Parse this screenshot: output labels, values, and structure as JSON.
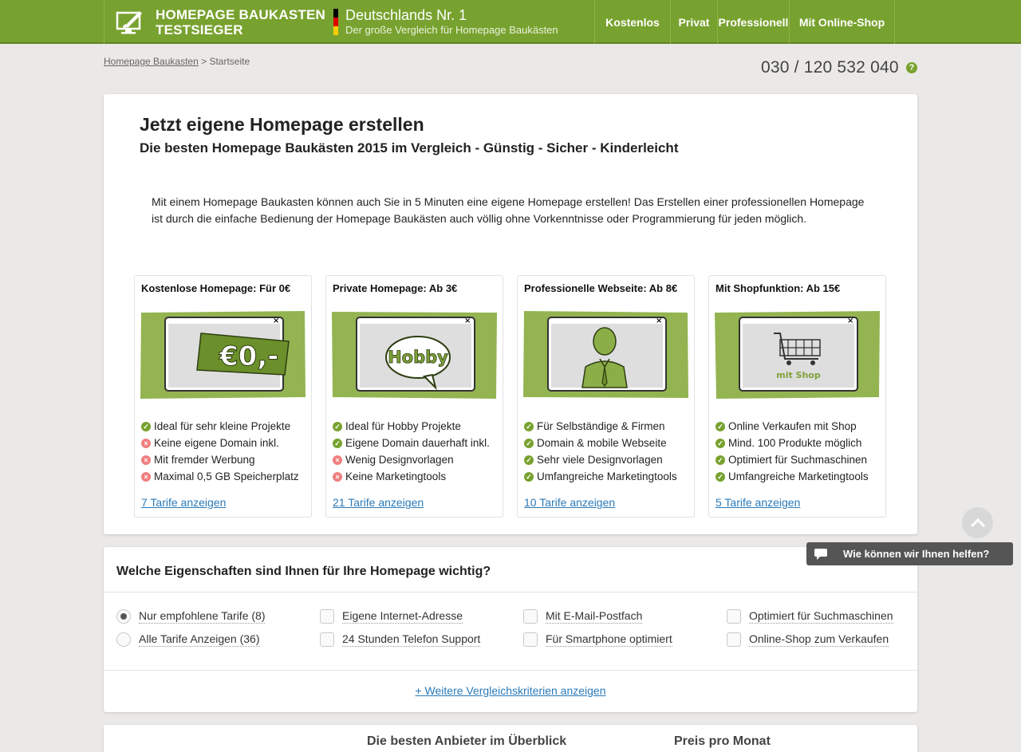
{
  "header": {
    "logo_line1": "HOMEPAGE BAUKASTEN",
    "logo_line2": "TESTSIEGER",
    "tagline_title": "Deutschlands Nr. 1",
    "tagline_sub": "Der große Vergleich für Homepage Baukästen",
    "nav": [
      "Kostenlos",
      "Privat",
      "Professionell",
      "Mit Online-Shop"
    ],
    "brand_color": "#78a22f"
  },
  "breadcrumb": {
    "link": "Homepage Baukasten",
    "separator": ">",
    "current": "Startseite"
  },
  "phone": "030 / 120 532 040",
  "hero": {
    "title": "Jetzt eigene Homepage erstellen",
    "subtitle": "Die besten Homepage Baukästen 2015 im Vergleich - Günstig - Sicher - Kinderleicht",
    "intro": "Mit einem Homepage Baukasten können auch Sie in 5 Minuten eine eigene Homepage erstellen! Das Erstellen einer professionellen Homepage ist durch die einfache Bedienung der Homepage Baukästen auch völlig ohne Vorkenntnisse oder Programmierung für jeden möglich."
  },
  "products": [
    {
      "title": "Kostenlose Homepage: Für 0€",
      "image_label": "€0,-",
      "features": [
        {
          "text": "Ideal für sehr kleine Projekte",
          "ok": true
        },
        {
          "text": "Keine eigene Domain inkl.",
          "ok": false
        },
        {
          "text": "Mit fremder Werbung",
          "ok": false
        },
        {
          "text": "Maximal 0,5 GB Speicherplatz",
          "ok": false
        }
      ],
      "link": "7 Tarife anzeigen"
    },
    {
      "title": "Private Homepage: Ab 3€",
      "image_label": "Hobby",
      "features": [
        {
          "text": "Ideal für Hobby Projekte",
          "ok": true
        },
        {
          "text": "Eigene Domain dauerhaft inkl.",
          "ok": true
        },
        {
          "text": "Wenig Designvorlagen",
          "ok": false
        },
        {
          "text": "Keine Marketingtools",
          "ok": false
        }
      ],
      "link": "21 Tarife anzeigen"
    },
    {
      "title": "Professionelle Webseite: Ab 8€",
      "image_label": "",
      "features": [
        {
          "text": "Für Selbständige & Firmen",
          "ok": true
        },
        {
          "text": "Domain & mobile Webseite",
          "ok": true
        },
        {
          "text": "Sehr viele Designvorlagen",
          "ok": true
        },
        {
          "text": "Umfangreiche Marketingtools",
          "ok": true
        }
      ],
      "link": "10 Tarife anzeigen"
    },
    {
      "title": "Mit Shopfunktion: Ab 15€",
      "image_label": "mit Shop",
      "features": [
        {
          "text": "Online Verkaufen mit Shop",
          "ok": true
        },
        {
          "text": "Mind. 100 Produkte möglich",
          "ok": true
        },
        {
          "text": "Optimiert für Suchmaschinen",
          "ok": true
        },
        {
          "text": "Umfangreiche Marketingtools",
          "ok": true
        }
      ],
      "link": "5 Tarife anzeigen"
    }
  ],
  "properties": {
    "title": "Welche Eigenschaften sind Ihnen für Ihre Homepage wichtig?",
    "radios": [
      {
        "label": "Nur empfohlene Tarife (8)",
        "checked": true
      },
      {
        "label": "Alle Tarife Anzeigen (36)",
        "checked": false
      }
    ],
    "checkboxes": [
      "Eigene Internet-Adresse",
      "24 Stunden Telefon Support",
      "Mit E-Mail-Postfach",
      "Für Smartphone optimiert",
      "Optimiert für Suchmaschinen",
      "Online-Shop zum Verkaufen"
    ],
    "more_link": "+ Weitere Vergleichskriterien anzeigen"
  },
  "table_header": {
    "col1": "Die besten Anbieter im Überblick",
    "col2": "Preis pro Monat"
  },
  "chat": {
    "label": "Wie können wir Ihnen helfen?"
  }
}
